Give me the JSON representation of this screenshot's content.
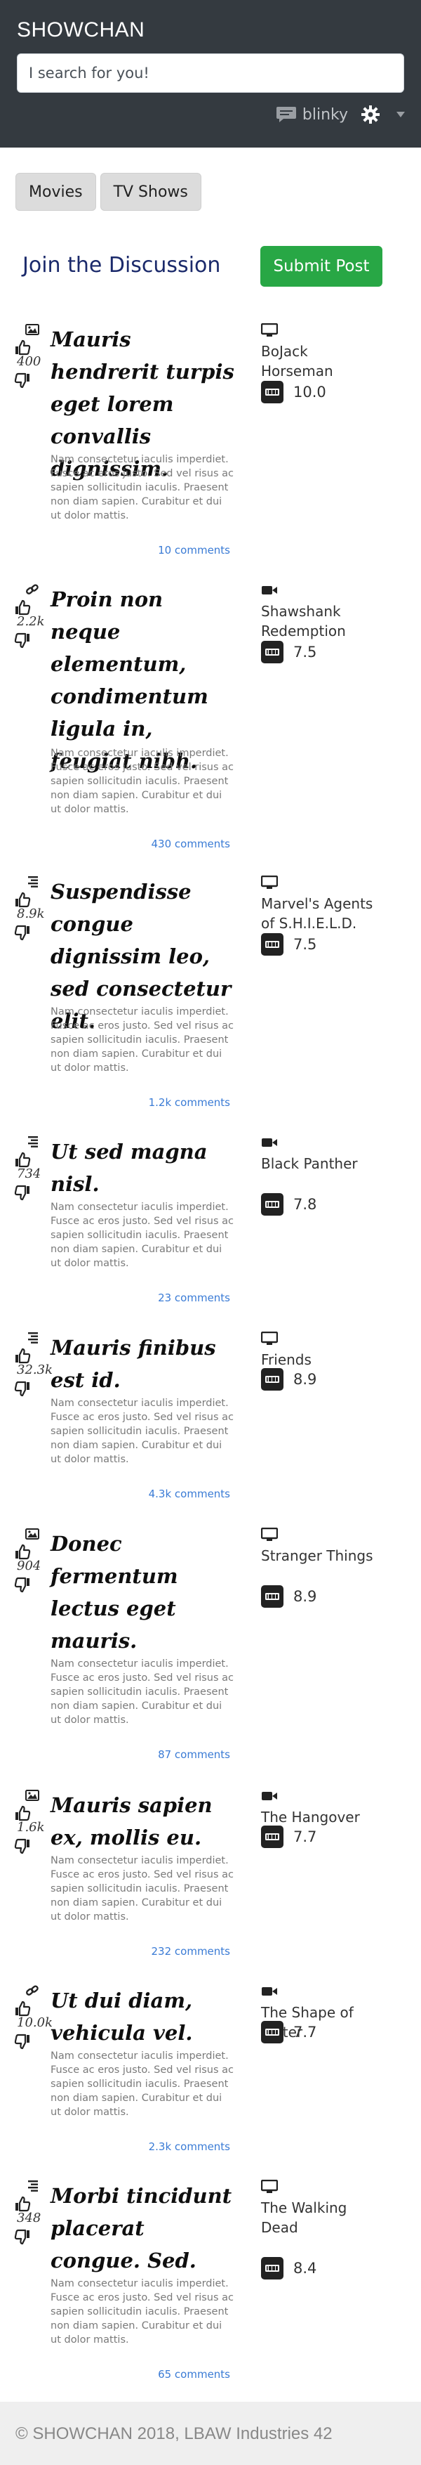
{
  "header": {
    "brand": "SHOWCHAN",
    "search_placeholder": "I search for you!",
    "username": "blinky",
    "icons": [
      "chat-icon",
      "gear-icon",
      "caret-down-icon"
    ]
  },
  "tabs": [
    {
      "label": "Movies"
    },
    {
      "label": "TV Shows"
    }
  ],
  "discussion": {
    "title": "Join the Discussion",
    "submit_label": "Submit Post"
  },
  "posts": [
    {
      "type_icon": "image-icon",
      "score": "400",
      "title": "Mauris hendrerit turpis eget lorem convallis dignissim.",
      "excerpt": "Nam consectetur iaculis imperdiet. Fusce ac eros justo. Sed vel risus ac sapien sollicitudin iaculis. Praesent non diam sapien. Curabitur et dui ut dolor mattis.",
      "comments": "10 comments",
      "media_icon": "tv-icon",
      "show": "BoJack Horseman",
      "rating": "10.0"
    },
    {
      "type_icon": "link-icon",
      "score": "2.2k",
      "title": "Proin non neque elementum, condimentum ligula in, feugiat nibh.",
      "excerpt": "Nam consectetur iaculis imperdiet. Fusce ac eros justo. Sed vel risus ac sapien sollicitudin iaculis. Praesent non diam sapien. Curabitur et dui ut dolor mattis.",
      "comments": "430 comments",
      "media_icon": "video-camera-icon",
      "show": "Shawshank Redemption",
      "rating": "7.5"
    },
    {
      "type_icon": "text-lines-icon",
      "score": "8.9k",
      "title": "Suspendisse congue dignissim leo, sed consectetur elit.",
      "excerpt": "Nam consectetur iaculis imperdiet. Fusce ac eros justo. Sed vel risus ac sapien sollicitudin iaculis. Praesent non diam sapien. Curabitur et dui ut dolor mattis.",
      "comments": "1.2k comments",
      "media_icon": "tv-icon",
      "show": "Marvel's Agents of S.H.I.E.L.D.",
      "rating": "7.5"
    },
    {
      "type_icon": "text-lines-icon",
      "score": "734",
      "title": "Ut sed magna nisl.",
      "excerpt": "Nam consectetur iaculis imperdiet. Fusce ac eros justo. Sed vel risus ac sapien sollicitudin iaculis. Praesent non diam sapien. Curabitur et dui ut dolor mattis.",
      "comments": "23 comments",
      "media_icon": "video-camera-icon",
      "show": "Black Panther",
      "rating": "7.8"
    },
    {
      "type_icon": "text-lines-icon",
      "score": "32.3k",
      "title": "Mauris finibus est id.",
      "excerpt": "Nam consectetur iaculis imperdiet. Fusce ac eros justo. Sed vel risus ac sapien sollicitudin iaculis. Praesent non diam sapien. Curabitur et dui ut dolor mattis.",
      "comments": "4.3k comments",
      "media_icon": "tv-icon",
      "show": "Friends",
      "rating": "8.9"
    },
    {
      "type_icon": "image-icon",
      "score": "904",
      "title": "Donec fermentum lectus eget mauris.",
      "excerpt": "Nam consectetur iaculis imperdiet. Fusce ac eros justo. Sed vel risus ac sapien sollicitudin iaculis. Praesent non diam sapien. Curabitur et dui ut dolor mattis.",
      "comments": "87 comments",
      "media_icon": "tv-icon",
      "show": "Stranger Things",
      "rating": "8.9"
    },
    {
      "type_icon": "image-icon",
      "score": "1.6k",
      "title": "Mauris sapien ex, mollis eu.",
      "excerpt": "Nam consectetur iaculis imperdiet. Fusce ac eros justo. Sed vel risus ac sapien sollicitudin iaculis. Praesent non diam sapien. Curabitur et dui ut dolor mattis.",
      "comments": "232 comments",
      "media_icon": "video-camera-icon",
      "show": "The Hangover",
      "rating": "7.7"
    },
    {
      "type_icon": "link-icon",
      "score": "10.0k",
      "title": "Ut dui diam, vehicula vel.",
      "excerpt": "Nam consectetur iaculis imperdiet. Fusce ac eros justo. Sed vel risus ac sapien sollicitudin iaculis. Praesent non diam sapien. Curabitur et dui ut dolor mattis.",
      "comments": "2.3k comments",
      "media_icon": "video-camera-icon",
      "show": "The Shape of Water",
      "rating": "7.7"
    },
    {
      "type_icon": "text-lines-icon",
      "score": "348",
      "title": "Morbi tincidunt placerat congue. Sed.",
      "excerpt": "Nam consectetur iaculis imperdiet. Fusce ac eros justo. Sed vel risus ac sapien sollicitudin iaculis. Praesent non diam sapien. Curabitur et dui ut dolor mattis.",
      "comments": "65 comments",
      "media_icon": "tv-icon",
      "show": "The Walking Dead",
      "rating": "8.4"
    }
  ],
  "footer": {
    "text": "© SHOWCHAN 2018, LBAW Industries 42"
  }
}
